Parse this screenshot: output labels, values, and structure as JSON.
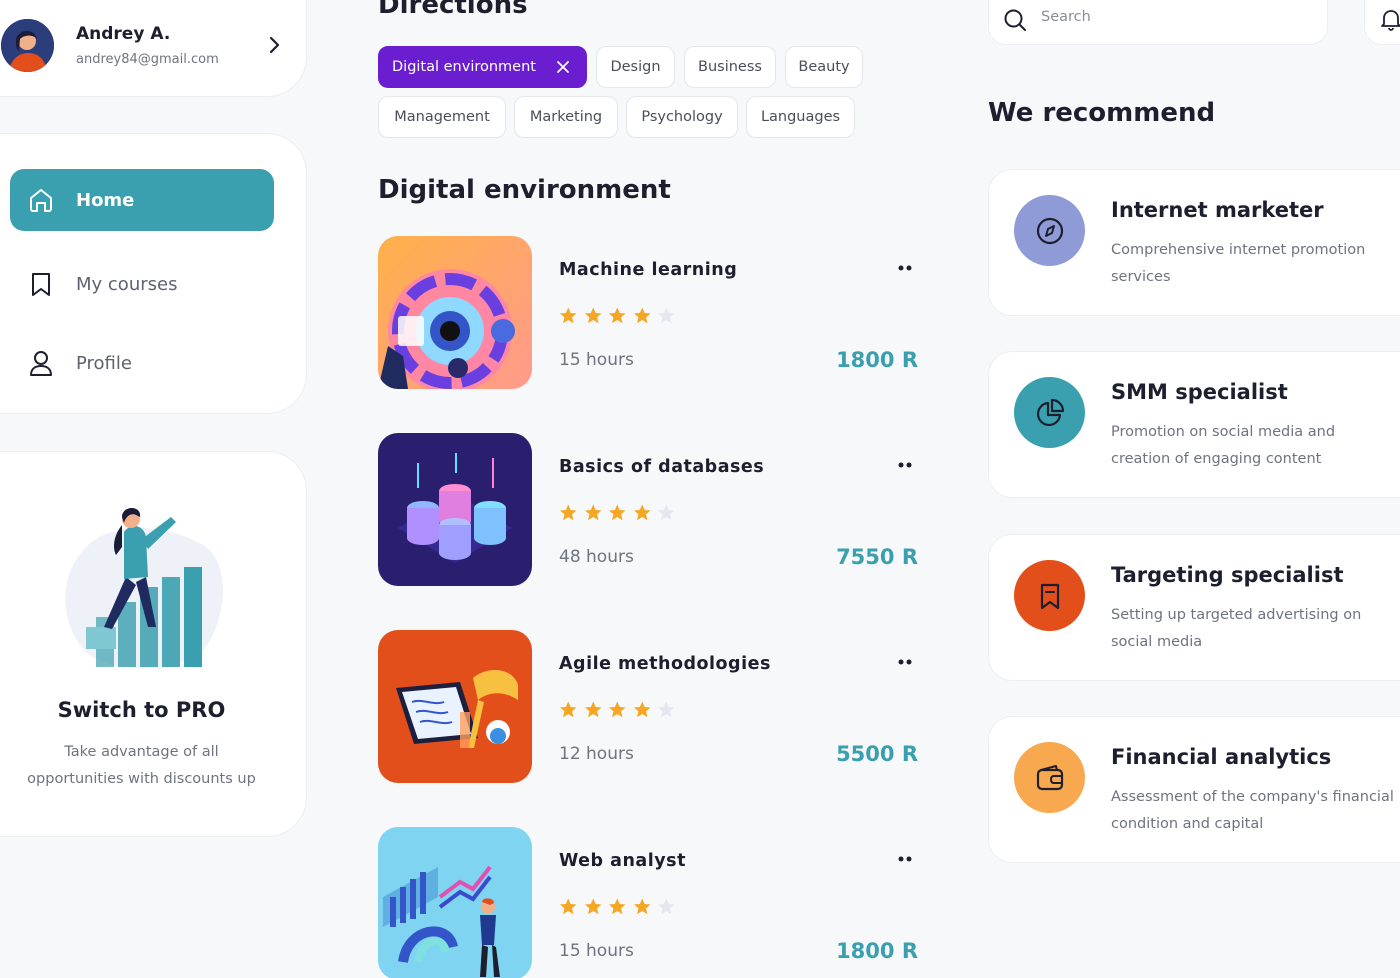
{
  "user": {
    "name": "Andrey A.",
    "email": "andrey84@gmail.com"
  },
  "nav": {
    "items": [
      {
        "label": "Home",
        "icon": "home-icon",
        "active": true
      },
      {
        "label": "My courses",
        "icon": "bookmark-icon",
        "active": false
      },
      {
        "label": "Profile",
        "icon": "user-icon",
        "active": false
      }
    ]
  },
  "promo": {
    "title": "Switch to PRO",
    "text_line1": "Take advantage of all",
    "text_line2": "opportunities with discounts up"
  },
  "directions": {
    "title": "Directions",
    "chips": [
      "Digital environment",
      "Design",
      "Business",
      "Beauty",
      "Management",
      "Marketing",
      "Psychology",
      "Languages"
    ],
    "active_chip": "Digital environment"
  },
  "section": {
    "title": "Digital environment"
  },
  "courses": [
    {
      "title": "Machine learning",
      "rating": 4,
      "rating_max": 5,
      "hours": "15 hours",
      "price": "1800 R",
      "thumb_color": "#f6a14a"
    },
    {
      "title": "Basics of databases",
      "rating": 4,
      "rating_max": 5,
      "hours": "48 hours",
      "price": "7550 R",
      "thumb_color": "#2a1f6e"
    },
    {
      "title": "Agile methodologies",
      "rating": 4,
      "rating_max": 5,
      "hours": "12 hours",
      "price": "5500 R",
      "thumb_color": "#e24f1b"
    },
    {
      "title": "Web analyst",
      "rating": 4,
      "rating_max": 5,
      "hours": "15 hours",
      "price": "1800 R",
      "thumb_color": "#7fd4f2"
    }
  ],
  "search": {
    "placeholder": "Search"
  },
  "recommend": {
    "title": "We recommend",
    "items": [
      {
        "title": "Internet marketer",
        "desc": "Comprehensive internet promotion services",
        "icon": "compass-icon",
        "color": "#8f9bd6"
      },
      {
        "title": "SMM specialist",
        "desc": "Promotion on social media and creation of engaging content",
        "icon": "pie-chart-icon",
        "color": "#3a9fae"
      },
      {
        "title": "Targeting specialist",
        "desc": "Setting up targeted advertising on social media",
        "icon": "bookmark-icon",
        "color": "#e24f1b"
      },
      {
        "title": "Financial analytics",
        "desc": "Assessment of the company's financial condition and capital",
        "icon": "wallet-icon",
        "color": "#f8a94f"
      }
    ]
  },
  "colors": {
    "accent_teal": "#3a9fae",
    "accent_purple": "#6a1ed0",
    "star_gold": "#f5a623",
    "star_empty": "#e4e6f0"
  }
}
